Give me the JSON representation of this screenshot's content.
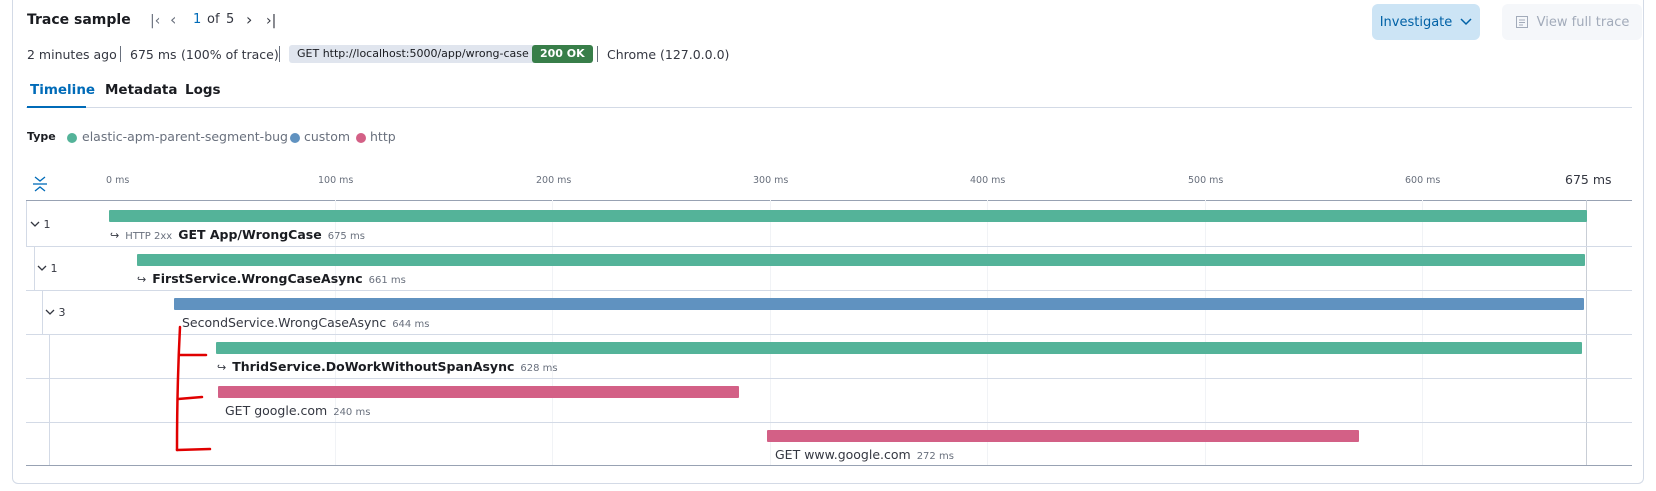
{
  "header": {
    "title": "Trace sample",
    "pager": {
      "current": "1",
      "of_label": "of",
      "total": "5"
    },
    "investigate_label": "Investigate",
    "view_full_trace_label": "View full trace"
  },
  "summary": {
    "age": "2 minutes ago",
    "duration": "675 ms",
    "percent_of_trace": "(100% of trace)",
    "request": "GET http://localhost:5000/app/wrong-case",
    "status": "200 OK",
    "user_agent": "Chrome (127.0.0.0)"
  },
  "tabs": [
    {
      "label": "Timeline",
      "active": true
    },
    {
      "label": "Metadata",
      "active": false
    },
    {
      "label": "Logs",
      "active": false
    }
  ],
  "legend": {
    "title": "Type",
    "items": [
      {
        "label": "elastic-apm-parent-segment-bug",
        "color": "#54b399"
      },
      {
        "label": "custom",
        "color": "#6092c0"
      },
      {
        "label": "http",
        "color": "#d36086"
      }
    ]
  },
  "axis": {
    "ticks": [
      "0 ms",
      "100 ms",
      "200 ms",
      "300 ms",
      "400 ms",
      "500 ms",
      "600 ms"
    ],
    "end_label": "675 ms",
    "max_ms": 675
  },
  "rows": [
    {
      "toggle": "1",
      "tag": "HTTP 2xx",
      "name": "GET App/WrongCase",
      "duration": "675 ms",
      "type": "elastic-apm-parent-segment-bug",
      "color": "#54b399"
    },
    {
      "toggle": "1",
      "tag": "",
      "name": "FirstService.WrongCaseAsync",
      "duration": "661 ms",
      "type": "elastic-apm-parent-segment-bug",
      "color": "#54b399"
    },
    {
      "toggle": "3",
      "tag": "",
      "name": "SecondService.WrongCaseAsync",
      "duration": "644 ms",
      "type": "custom",
      "color": "#6092c0"
    },
    {
      "toggle": "",
      "tag": "",
      "name": "ThridService.DoWorkWithoutSpanAsync",
      "duration": "628 ms",
      "type": "elastic-apm-parent-segment-bug",
      "color": "#54b399"
    },
    {
      "toggle": "",
      "tag": "",
      "name": "GET google.com",
      "duration": "240 ms",
      "type": "http",
      "color": "#d36086"
    },
    {
      "toggle": "",
      "tag": "",
      "name": "GET www.google.com",
      "duration": "272 ms",
      "type": "http",
      "color": "#d36086"
    }
  ]
}
